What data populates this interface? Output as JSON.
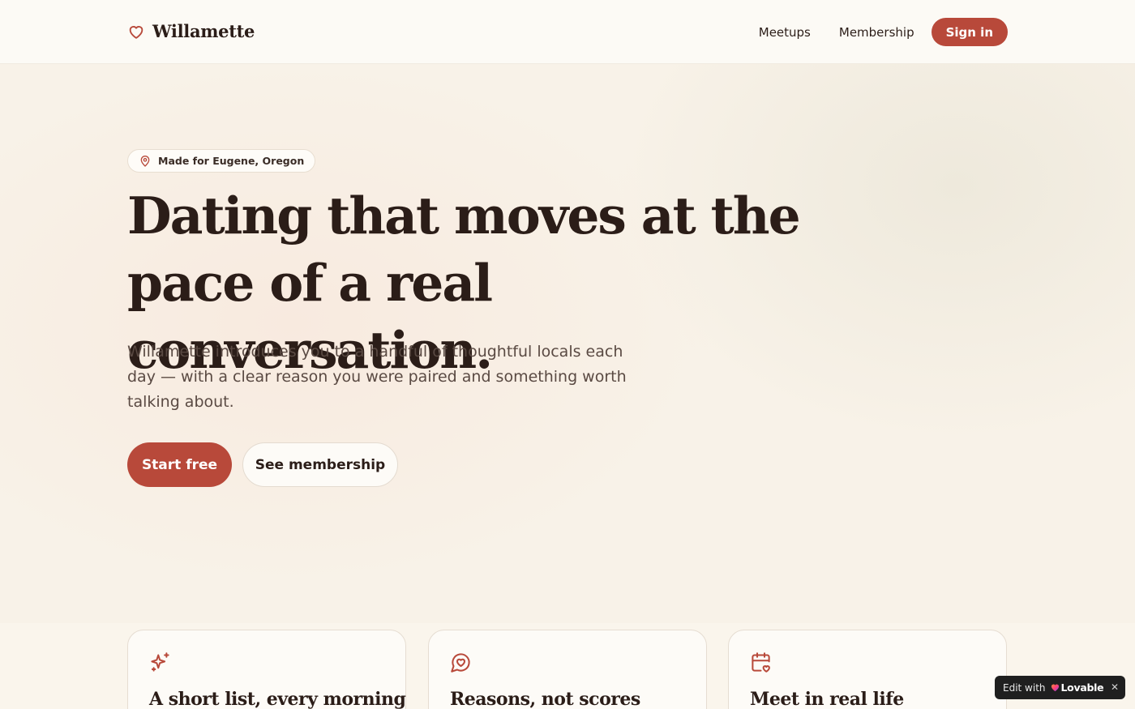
{
  "brand": {
    "name": "Willamette",
    "accent": "#b8493a"
  },
  "nav": {
    "items": [
      "Meetups",
      "Membership"
    ],
    "signin_label": "Sign in"
  },
  "hero": {
    "badge": "Made for Eugene, Oregon",
    "headline": "Dating that moves at the pace of a real conversation.",
    "subtext": "Willamette introduces you to a handful of thoughtful locals each day — with a clear reason you were paired and something worth talking about.",
    "primary_cta": "Start free",
    "secondary_cta": "See membership"
  },
  "features": [
    {
      "icon": "sparkles-icon",
      "title": "A short list, every morning"
    },
    {
      "icon": "heart-chat-icon",
      "title": "Reasons, not scores"
    },
    {
      "icon": "calendar-heart-icon",
      "title": "Meet in real life"
    }
  ],
  "lovable_badge": {
    "prefix": "Edit with",
    "brand": "Lovable"
  }
}
